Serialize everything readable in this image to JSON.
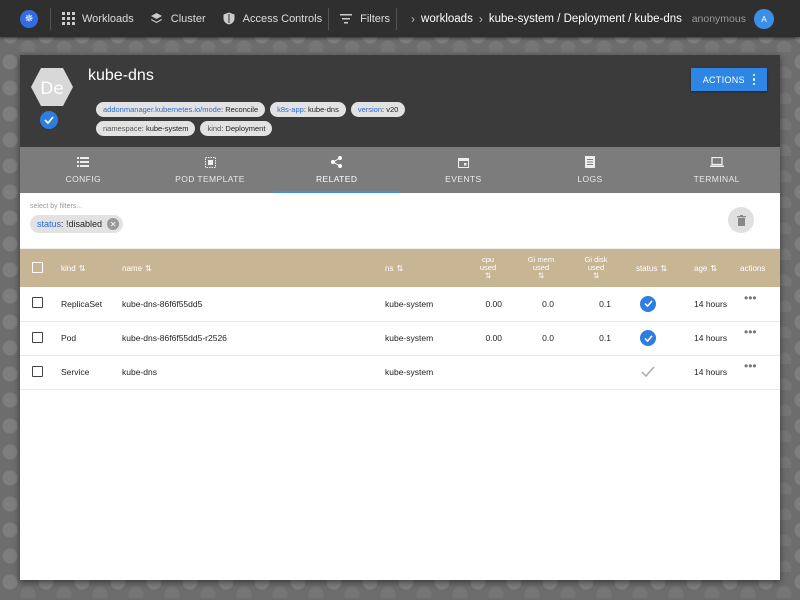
{
  "nav": {
    "workloads": "Workloads",
    "cluster": "Cluster",
    "access_controls": "Access Controls",
    "filters": "Filters"
  },
  "breadcrumb": {
    "root": "workloads",
    "path": "kube-system / Deployment / kube-dns"
  },
  "user": {
    "name": "anonymous",
    "initial": "A"
  },
  "resource": {
    "icon_text": "De",
    "title": "kube-dns",
    "labels_row1": [
      {
        "key": "addonmanager.kubernetes.io/mode",
        "value": "Reconcile"
      },
      {
        "key": "k8s-app",
        "value": "kube-dns"
      },
      {
        "key": "version",
        "value": "v20"
      }
    ],
    "labels_row2": [
      {
        "key": "namespace",
        "value": "kube-system"
      },
      {
        "key": "kind",
        "value": "Deployment"
      }
    ],
    "actions_label": "ACTIONS"
  },
  "tabs": [
    "CONFIG",
    "POD TEMPLATE",
    "RELATED",
    "EVENTS",
    "LOGS",
    "TERMINAL"
  ],
  "filter": {
    "placeholder": "select by filters...",
    "chip_key": "status",
    "chip_value": "!disabled"
  },
  "table": {
    "headers": {
      "kind": "kind",
      "name": "name",
      "ns": "ns",
      "cpu": [
        "cpu",
        "used"
      ],
      "gi_mem": [
        "Gi mem",
        "used"
      ],
      "gi_disk": [
        "Gi disk",
        "used"
      ],
      "status": "status",
      "age": "age",
      "actions": "actions"
    },
    "rows": [
      {
        "kind": "ReplicaSet",
        "name": "kube-dns-86f6f55dd5",
        "ns": "kube-system",
        "cpu": "0.00",
        "mem": "0.0",
        "disk": "0.1",
        "status": "ok",
        "age": "14 hours"
      },
      {
        "kind": "Pod",
        "name": "kube-dns-86f6f55dd5-r2526",
        "ns": "kube-system",
        "cpu": "0.00",
        "mem": "0.0",
        "disk": "0.1",
        "status": "ok",
        "age": "14 hours"
      },
      {
        "kind": "Service",
        "name": "kube-dns",
        "ns": "kube-system",
        "cpu": "",
        "mem": "",
        "disk": "",
        "status": "none",
        "age": "14 hours"
      }
    ]
  },
  "colors": {
    "accent": "#2e86e4",
    "header_bg": "#3b3b3b",
    "tab_bg": "#7c7c7c",
    "table_head": "#c8b594"
  }
}
